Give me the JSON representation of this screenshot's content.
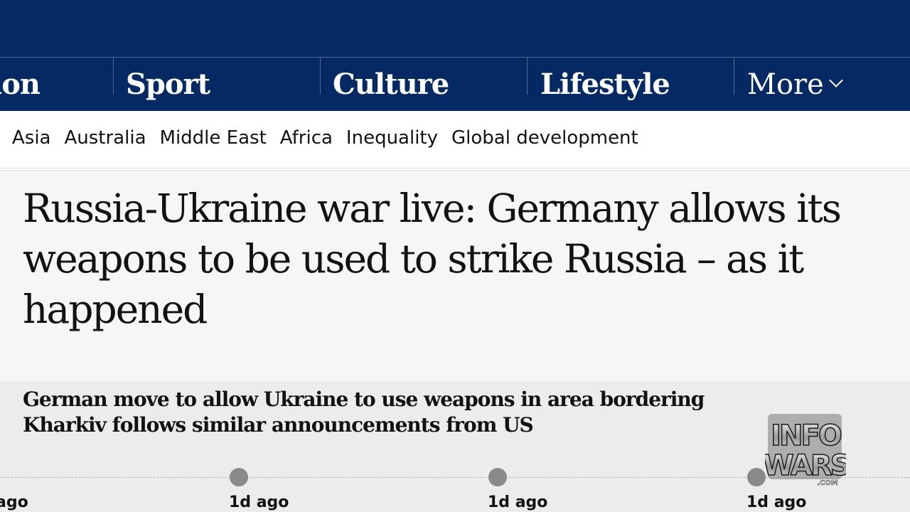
{
  "pillars": [
    {
      "label": "ion"
    },
    {
      "label": "Sport"
    },
    {
      "label": "Culture"
    },
    {
      "label": "Lifestyle"
    }
  ],
  "more_label": "More",
  "subnav": [
    "Asia",
    "Australia",
    "Middle East",
    "Africa",
    "Inequality",
    "Global development"
  ],
  "headline": "Russia-Ukraine war live: Germany allows its weapons to be used to strike Russia – as it happened",
  "standfirst": "German move to allow Ukraine to use weapons in area bordering Kharkiv follows similar announcements from US",
  "timeline": [
    "ago",
    "1d ago",
    "1d ago",
    "1d ago"
  ],
  "watermark": {
    "line1": "INFO",
    "line2": "WARS",
    "suffix": ".COM"
  },
  "colors": {
    "masthead": "#052962",
    "divider": "#506991",
    "page_background": "#f6f6f6",
    "standfirst_background": "#ececec",
    "timeline_dot": "#8a8a8a"
  },
  "icons": {
    "more_chevron": "chevron-down-icon"
  }
}
